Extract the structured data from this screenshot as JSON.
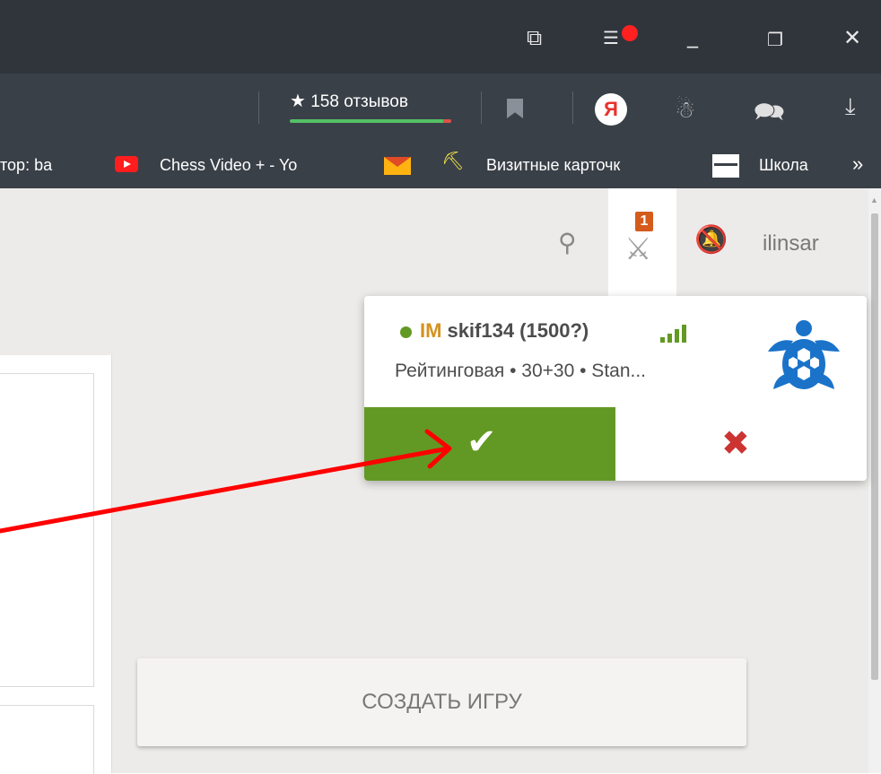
{
  "browser": {
    "reviews_label": "158 отзывов",
    "bookmarks": {
      "author_tab": "тор: ba",
      "chess_video": "Chess Video + - Yo",
      "business_cards": "Визитные карточк",
      "school": "Школа",
      "more_glyph": "»"
    },
    "icons": [
      "bookmarks-manager-icon",
      "menu-icon",
      "minimize-icon",
      "restore-icon",
      "close-icon",
      "bookmark-icon",
      "yandex-icon",
      "extension-icon",
      "message-icon",
      "download-icon"
    ]
  },
  "site": {
    "username": "ilinsar",
    "challenge_count": "1",
    "create_game_label": "СОЗДАТЬ ИГРУ"
  },
  "challenge": {
    "player_title": "IM",
    "player_name": "skif134 (1500?)",
    "description": "Рейтинговая • 30+30 • Stan...",
    "accept_glyph": "✔",
    "decline_glyph": "✖"
  },
  "colors": {
    "accept_green": "#629924",
    "decline_red": "#cc3333",
    "title_gold": "#d59120",
    "badge_orange": "#d55b1c",
    "annotation_red": "#ff0000"
  }
}
